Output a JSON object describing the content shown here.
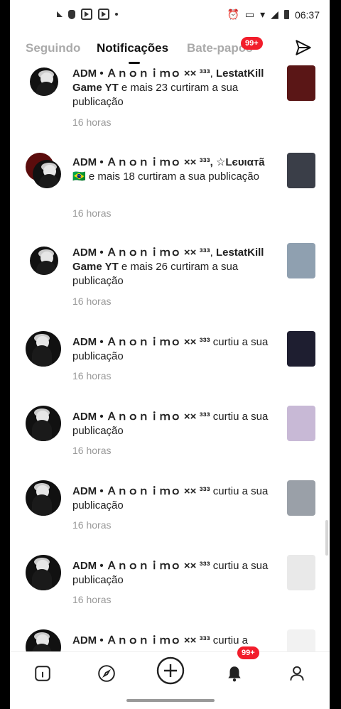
{
  "status_bar": {
    "time": "06:37"
  },
  "tabs": [
    {
      "label": "Seguindo"
    },
    {
      "label": "Notificações"
    },
    {
      "label": "Bate-papos",
      "badge": "99+"
    }
  ],
  "notifications": [
    {
      "actor": "ADM • Ａｎｏｎｉｍｏ ×× ³³³",
      "other": "LestatKill Game  YT",
      "rest": " e mais 23 curtiram a sua publicação",
      "time": "16 horas"
    },
    {
      "actor": "ADM • Ａｎｏｎｉｍｏ ×× ³³³,",
      "other": "☆Lєυιαтã 🇧🇷",
      "rest": " e mais 18 curtiram a sua publicação",
      "time": "16 horas"
    },
    {
      "actor": "ADM • Ａｎｏｎｉｍｏ ×× ³³³",
      "other": "LestatKill Game  YT",
      "rest": " e mais 26 curtiram a sua publicação",
      "time": "16 horas"
    },
    {
      "actor": "ADM • Ａｎｏｎｉｍｏ ×× ³³³",
      "other": "",
      "rest": " curtiu a sua publicação",
      "time": "16 horas"
    },
    {
      "actor": "ADM • Ａｎｏｎｉｍｏ ×× ³³³",
      "other": "",
      "rest": " curtiu a sua publicação",
      "time": "16 horas"
    },
    {
      "actor": "ADM • Ａｎｏｎｉｍｏ ×× ³³³",
      "other": "",
      "rest": " curtiu a sua publicação",
      "time": "16 horas"
    },
    {
      "actor": "ADM • Ａｎｏｎｉｍｏ ×× ³³³",
      "other": "",
      "rest": " curtiu a sua publicação",
      "time": "16 horas"
    },
    {
      "actor": "ADM • Ａｎｏｎｉｍｏ ×× ³³³",
      "other": "",
      "rest": " curtiu a",
      "time": ""
    }
  ],
  "bottom_nav": [
    {
      "icon": "home-icon"
    },
    {
      "icon": "explore-icon"
    },
    {
      "icon": "create-icon"
    },
    {
      "icon": "bell-icon",
      "badge": "99+"
    },
    {
      "icon": "profile-icon"
    }
  ],
  "colors": {
    "accent": "#f21d2b",
    "text": "#222222",
    "muted": "#999999"
  }
}
